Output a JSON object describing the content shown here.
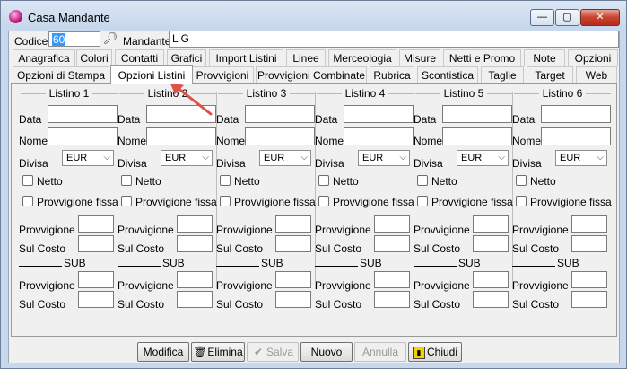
{
  "window": {
    "title": "Casa Mandante",
    "controls": {
      "minimize": "—",
      "maximize": "▢",
      "close": "✕"
    }
  },
  "header": {
    "codice_label": "Codice",
    "codice_value": "60",
    "mandante_label": "Mandante",
    "mandante_value": "L                    G"
  },
  "tabs_row1": [
    "Anagrafica",
    "Colori",
    "Contatti",
    "Grafici",
    "Import Listini",
    "Linee",
    "Merceologia",
    "Misure",
    "Netti e Promo",
    "Note",
    "Opzioni"
  ],
  "tabs_row2": [
    "Opzioni di Stampa",
    "Opzioni Listini",
    "Provvigioni",
    "Provvigioni Combinate",
    "Rubrica",
    "Scontistica",
    "Taglie",
    "Target",
    "Web"
  ],
  "active_tab": "Opzioni Listini",
  "listini": [
    {
      "title": "Listino 1",
      "valuta": "EUR"
    },
    {
      "title": "Listino 2",
      "valuta": "EUR"
    },
    {
      "title": "Listino 3",
      "valuta": "EUR"
    },
    {
      "title": "Listino 4",
      "valuta": "EUR"
    },
    {
      "title": "Listino 5",
      "valuta": "EUR"
    },
    {
      "title": "Listino 6",
      "valuta": "EUR"
    }
  ],
  "field_labels": {
    "data": "Data",
    "nome": "Nome",
    "divisa": "Divisa",
    "netto": "Netto",
    "provvigione_fissa": "Provvigione fissa",
    "provvigione": "Provvigione",
    "sul_costo": "Sul Costo",
    "sub": "SUB"
  },
  "buttons": {
    "modifica": "Modifica",
    "elimina": "Elimina",
    "salva": "Salva",
    "nuovo": "Nuovo",
    "annulla": "Annulla",
    "chiudi": "Chiudi"
  },
  "icons": {
    "app": "app-orb-icon",
    "find": "binoculars-icon",
    "elimina": "trash-icon",
    "salva": "checkmark-icon",
    "chiudi": "exit-door-icon"
  },
  "colors": {
    "selection": "#3399ff",
    "annotation_arrow": "#e0514a"
  }
}
